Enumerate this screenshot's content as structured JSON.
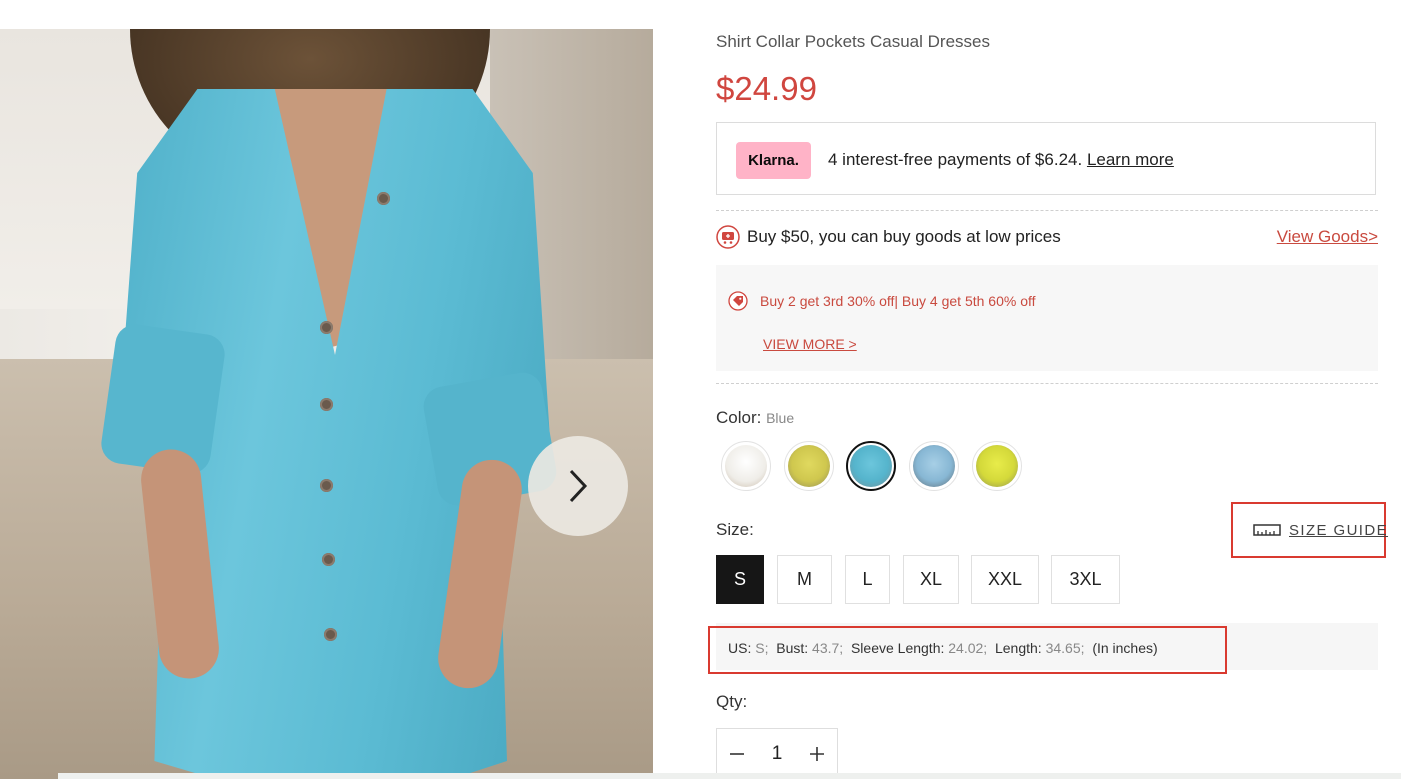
{
  "product": {
    "title": "Shirt Collar Pockets Casual Dresses",
    "price": "$24.99"
  },
  "gallery": {
    "image_alt": "blue shirt dress product photo",
    "next_icon": "chevron-right-icon"
  },
  "klarna": {
    "logo": "Klarna.",
    "text": "4 interest-free payments of $6.24.",
    "link": "Learn more"
  },
  "promo": {
    "icon": "cart-icon",
    "text": "Buy $50, you can buy goods at low prices",
    "link": "View Goods>"
  },
  "discount": {
    "icon": "tag-icon",
    "text": "Buy 2 get 3rd 30% off| Buy 4 get 5th 60% off",
    "more": "VIEW MORE >"
  },
  "color": {
    "label": "Color:",
    "selected": "Blue",
    "swatches": [
      {
        "name": "White",
        "color": "#f1f0ec"
      },
      {
        "name": "Yellow-Green",
        "color": "#d7d05a"
      },
      {
        "name": "Blue",
        "color": "#5fb8cf"
      },
      {
        "name": "Light Blue",
        "color": "#8fbedb"
      },
      {
        "name": "Yellow",
        "color": "#dde23f"
      }
    ]
  },
  "size": {
    "label": "Size:",
    "guide": "SIZE GUIDE",
    "guide_icon": "ruler-icon",
    "options": [
      "S",
      "M",
      "L",
      "XL",
      "XXL",
      "3XL"
    ],
    "selected": "S"
  },
  "measure": {
    "us_label": "US:",
    "us": "S;",
    "bust_label": "Bust:",
    "bust": "43.7;",
    "sleeve_label": "Sleeve Length:",
    "sleeve": "24.02;",
    "length_label": "Length:",
    "length": "34.65;",
    "unit": "(In inches)"
  },
  "qty": {
    "label": "Qty:",
    "value": "1",
    "minus_icon": "minus-icon",
    "plus_icon": "plus-icon"
  },
  "colors": {
    "price": "#d0463f",
    "accent_link": "#c94a3f",
    "klarna_pink": "#ffb3c7",
    "highlight": "#d93a30"
  }
}
